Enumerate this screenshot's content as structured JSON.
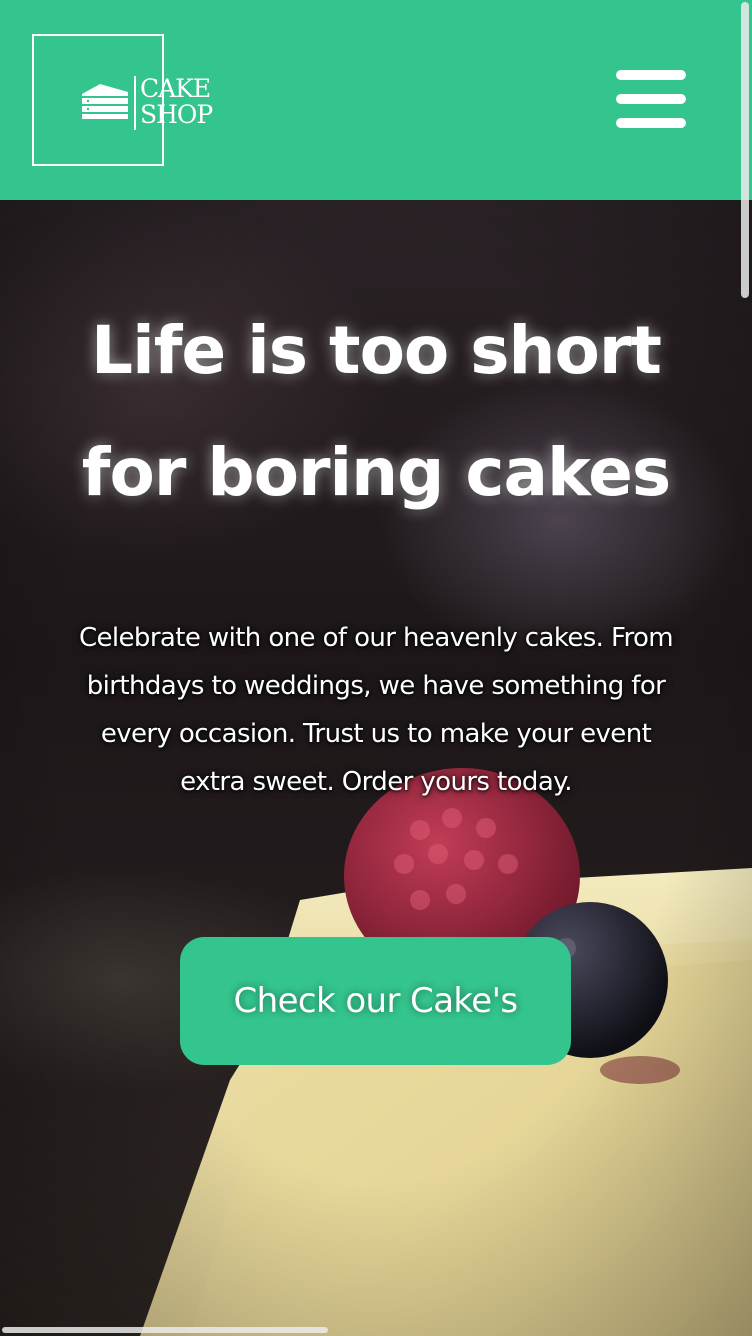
{
  "header": {
    "logo_line1": "CAKE",
    "logo_line2": "SHOP",
    "logo_icon": "cake-slice-icon",
    "menu_icon": "hamburger-menu-icon",
    "background_color": "#34c48d"
  },
  "hero": {
    "headline_line1": "Life is too short",
    "headline_line2": "for boring cakes",
    "description_line1": "Celebrate with one of our heavenly cakes. From",
    "description_line2": "birthdays to weddings, we have something for",
    "description_line3": "every occasion. Trust us to make your event",
    "description_line4": "extra sweet. Order yours today.",
    "cta_label": "Check our Cake's",
    "cta_color": "#34c48d"
  }
}
